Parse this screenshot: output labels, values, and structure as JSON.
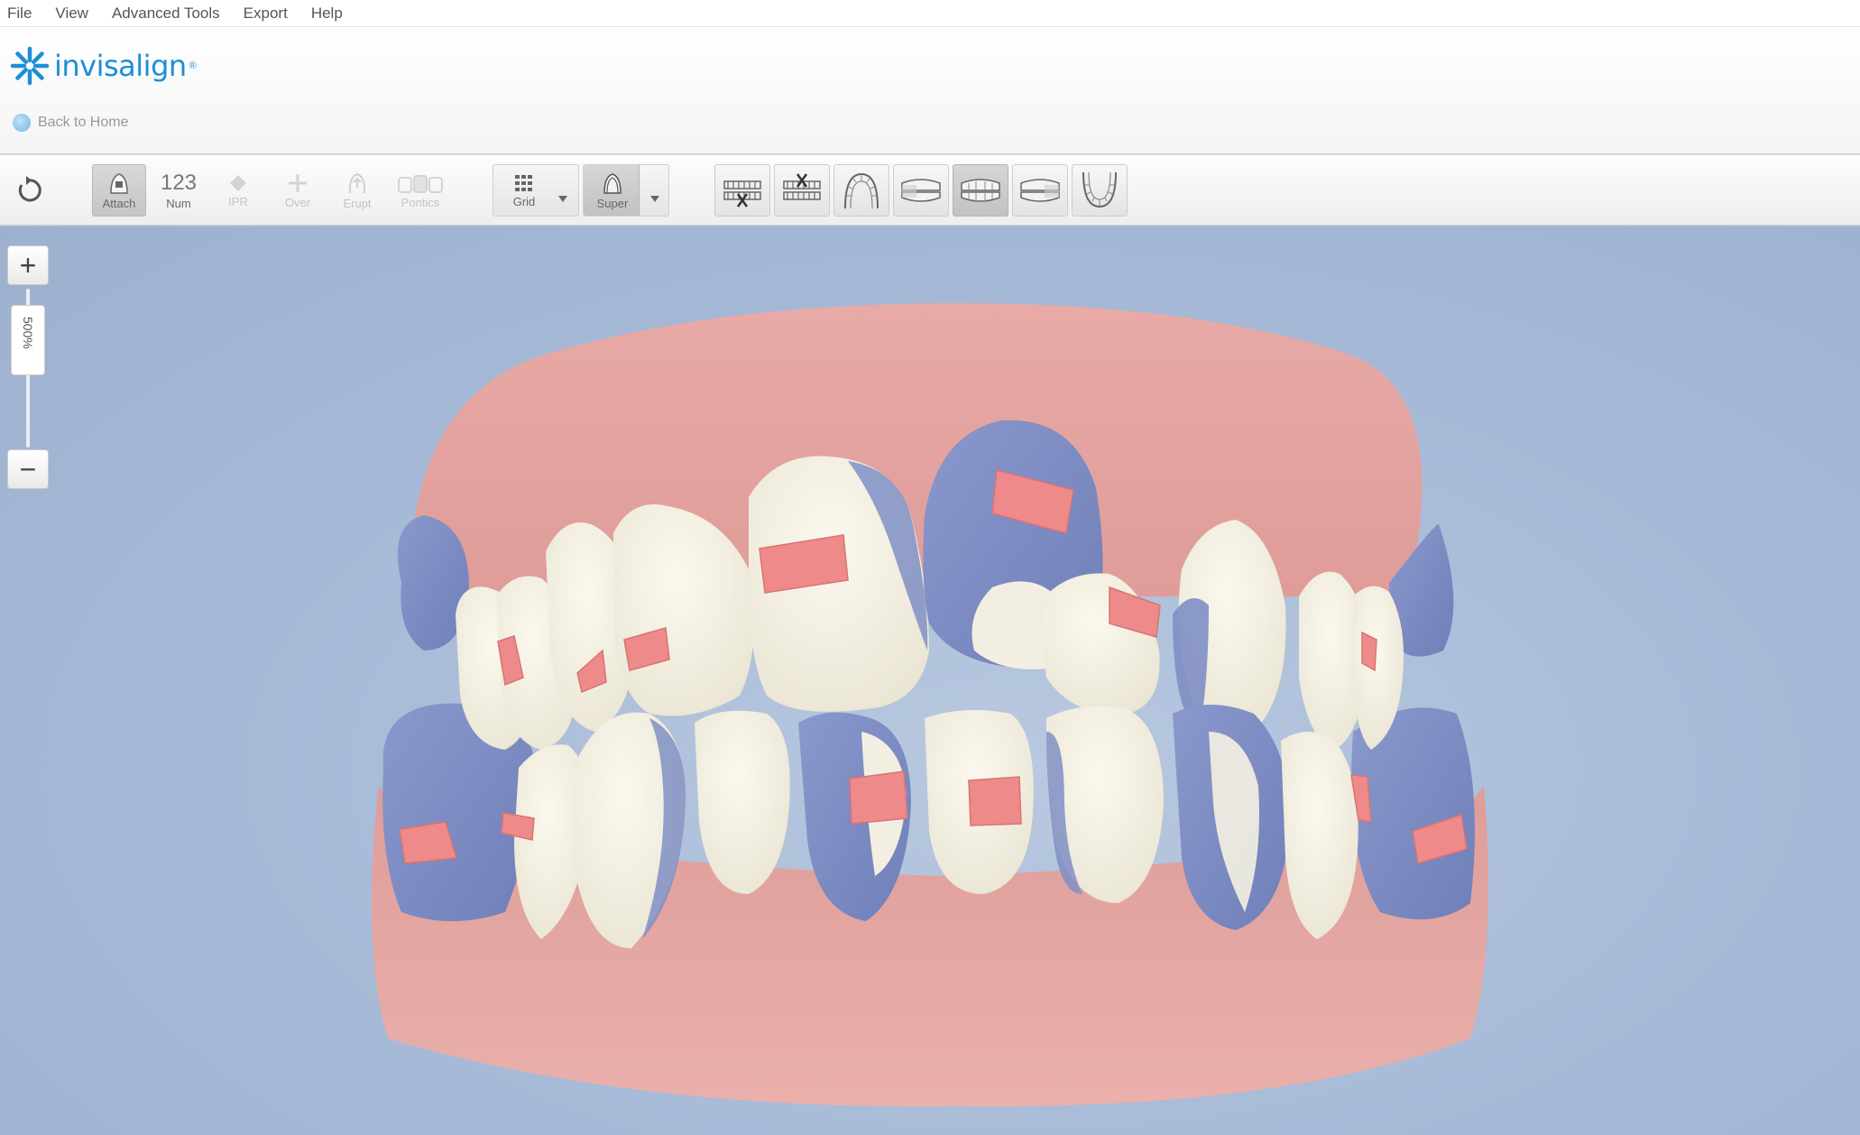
{
  "menu": [
    "File",
    "View",
    "Advanced Tools",
    "Export",
    "Help"
  ],
  "brand": {
    "name": "invisalign",
    "mark": "®",
    "color": "#1d8fd6"
  },
  "nav": {
    "back_label": "Back to Home"
  },
  "toolbar": {
    "tools": [
      {
        "label": "Attach",
        "icon": "attachment-icon",
        "state": "active"
      },
      {
        "label": "Num",
        "glyph": "123",
        "icon": "numbering-icon",
        "state": "normal"
      },
      {
        "label": "IPR",
        "icon": "ipr-icon",
        "state": "disabled"
      },
      {
        "label": "Over",
        "icon": "overcorrection-icon",
        "state": "disabled"
      },
      {
        "label": "Erupt",
        "icon": "erupt-icon",
        "state": "disabled"
      },
      {
        "label": "Pontics",
        "icon": "pontics-icon",
        "state": "disabled"
      }
    ],
    "dropdowns": [
      {
        "label": "Grid",
        "icon": "grid-icon"
      },
      {
        "label": "Super",
        "icon": "superimpose-icon",
        "state": "active"
      }
    ],
    "views": [
      "upper-jaw-remove-view-icon",
      "lower-jaw-remove-view-icon",
      "upper-occlusal-view-icon",
      "right-buccal-view-icon",
      "front-view-icon",
      "left-buccal-view-icon",
      "lower-occlusal-view-icon"
    ]
  },
  "zoom": {
    "level": "500%"
  },
  "colors": {
    "gum": "#e6a6a2",
    "tooth": "#f2efe2",
    "overlay": "#7f8fc4",
    "attachment": "#ee8888",
    "background": "#a9bcd8"
  }
}
